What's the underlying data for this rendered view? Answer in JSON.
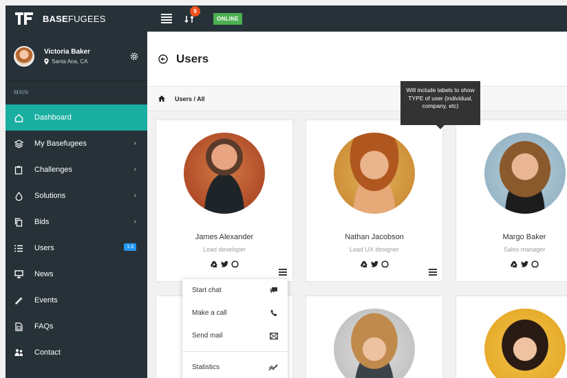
{
  "brand": {
    "bold": "BASE",
    "light": "FUGEES"
  },
  "topbar": {
    "notification_count": "9",
    "status": "ONLINE"
  },
  "profile": {
    "name": "Victoria Baker",
    "location": "Santa Ana, CA"
  },
  "sidebar": {
    "section_label": "MAIN",
    "items": [
      {
        "label": "Dashboard",
        "icon": "home-icon"
      },
      {
        "label": "My Basefugees",
        "icon": "layers-icon"
      },
      {
        "label": "Challenges",
        "icon": "clipboard-icon"
      },
      {
        "label": "Solutions",
        "icon": "drop-icon"
      },
      {
        "label": "Bids",
        "icon": "copy-icon"
      },
      {
        "label": "Users",
        "icon": "list-icon",
        "badge": "1.3"
      },
      {
        "label": "News",
        "icon": "monitor-icon"
      },
      {
        "label": "Events",
        "icon": "pen-icon"
      },
      {
        "label": "FAQs",
        "icon": "document-icon"
      },
      {
        "label": "Contact",
        "icon": "people-icon"
      }
    ]
  },
  "page": {
    "title": "Users",
    "breadcrumb": "Users / All"
  },
  "tooltip": {
    "text": "Will include labels to show TYPE of user (individual, company, etc)"
  },
  "cards": [
    {
      "name": "James Alexander",
      "role": "Lead developer"
    },
    {
      "name": "Nathan Jacobson",
      "role": "Lead UX designer"
    },
    {
      "name": "Margo Baker",
      "role": "Sales manager"
    }
  ],
  "card_menu": {
    "items": [
      "Start chat",
      "Make a call",
      "Send mail",
      "Statistics"
    ]
  },
  "colors": {
    "accent": "#1aaea0",
    "sidebar": "#263238",
    "badge": "#2196f3",
    "notification": "#f4511e",
    "status": "#4caf50"
  }
}
